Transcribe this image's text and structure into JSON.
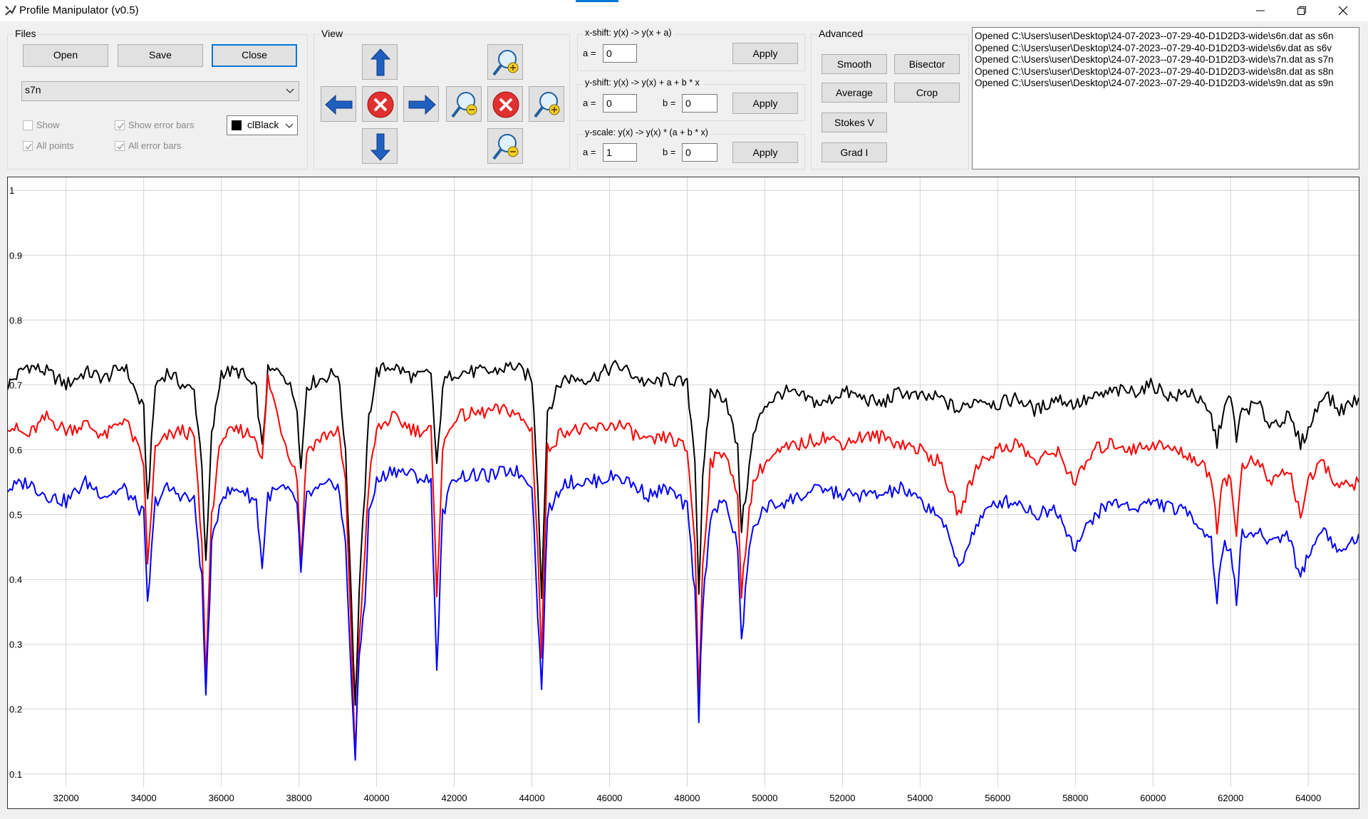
{
  "window": {
    "title": "Profile Manipulator (v0.5)"
  },
  "files": {
    "group_label": "Files",
    "open_label": "Open",
    "save_label": "Save",
    "close_label": "Close",
    "selected_profile": "s7n",
    "show_label": "Show",
    "show_checked": false,
    "show_error_bars_label": "Show error bars",
    "show_error_bars_checked": true,
    "all_points_label": "All points",
    "all_points_checked": true,
    "all_error_bars_label": "All error bars",
    "all_error_bars_checked": true,
    "color_value": "clBlack",
    "color_swatch": "#000000"
  },
  "view": {
    "group_label": "View"
  },
  "xshift": {
    "label": "x-shift: y(x) -> y(x + a)",
    "a_label": "a =",
    "a_value": "0",
    "apply_label": "Apply"
  },
  "yshift": {
    "label": "y-shift: y(x) -> y(x) + a + b * x",
    "a_label": "a =",
    "a_value": "0",
    "b_label": "b =",
    "b_value": "0",
    "apply_label": "Apply"
  },
  "yscale": {
    "label": "y-scale: y(x) -> y(x) * (a + b * x)",
    "a_label": "a =",
    "a_value": "1",
    "b_label": "b =",
    "b_value": "0",
    "apply_label": "Apply"
  },
  "advanced": {
    "group_label": "Advanced",
    "smooth_label": "Smooth",
    "bisector_label": "Bisector",
    "average_label": "Average",
    "crop_label": "Crop",
    "stokes_label": "Stokes V",
    "grad_label": "Grad I"
  },
  "log": {
    "lines": [
      "Opened C:\\Users\\user\\Desktop\\24-07-2023--07-29-40-D1D2D3-wide\\s6n.dat as s6n",
      "Opened C:\\Users\\user\\Desktop\\24-07-2023--07-29-40-D1D2D3-wide\\s6v.dat as s6v",
      "Opened C:\\Users\\user\\Desktop\\24-07-2023--07-29-40-D1D2D3-wide\\s7n.dat as s7n",
      "Opened C:\\Users\\user\\Desktop\\24-07-2023--07-29-40-D1D2D3-wide\\s8n.dat as s8n",
      "Opened C:\\Users\\user\\Desktop\\24-07-2023--07-29-40-D1D2D3-wide\\s9n.dat as s9n"
    ]
  },
  "icons": {
    "app": "app-icon",
    "minimize": "minimize-icon",
    "maximize": "restore-icon",
    "close": "close-icon",
    "up": "arrow-up-icon",
    "down": "arrow-down-icon",
    "left": "arrow-left-icon",
    "right": "arrow-right-icon",
    "reset": "reset-x-icon",
    "zoom_in": "zoom-in-icon",
    "zoom_out": "zoom-out-icon"
  },
  "chart_data": {
    "type": "line",
    "xlim": [
      30500,
      65300
    ],
    "ylim": [
      0.08,
      1.02
    ],
    "grid": true,
    "x_ticks": [
      32000,
      34000,
      36000,
      38000,
      40000,
      42000,
      44000,
      46000,
      48000,
      50000,
      52000,
      54000,
      56000,
      58000,
      60000,
      62000,
      64000
    ],
    "y_ticks": [
      0.1,
      0.2,
      0.3,
      0.4,
      0.5,
      0.6,
      0.7,
      0.8,
      0.9,
      1
    ],
    "y_tick_labels": [
      "0.1",
      "0.2",
      "0.3",
      "0.4",
      "0.5",
      "0.6",
      "0.7",
      "0.8",
      "0.9",
      "1"
    ],
    "series": [
      {
        "color": "#000000",
        "x": [
          30500,
          31000,
          31500,
          32000,
          32500,
          33000,
          33500,
          34000,
          34100,
          34300,
          34600,
          35000,
          35300,
          35500,
          35600,
          35750,
          36000,
          36500,
          36900,
          37050,
          37200,
          37600,
          37950,
          38050,
          38200,
          38600,
          39000,
          39200,
          39350,
          39450,
          39550,
          39700,
          39800,
          40000,
          40400,
          41000,
          41400,
          41550,
          41700,
          42000,
          43000,
          43500,
          44000,
          44150,
          44250,
          44400,
          44800,
          45500,
          46200,
          46500,
          47000,
          47500,
          48000,
          48200,
          48300,
          48400,
          48600,
          49000,
          49300,
          49400,
          49550,
          49700,
          50000,
          50500,
          51000,
          51500,
          52000,
          52500,
          53000,
          53500,
          54000,
          54500,
          55000,
          55500,
          56000,
          56500,
          57000,
          57500,
          58000,
          58500,
          59000,
          59500,
          60000,
          60500,
          61000,
          61500,
          61650,
          61800,
          62000,
          62150,
          62300,
          62700,
          63000,
          63500,
          63800,
          64000,
          64400,
          64800,
          65300
        ],
        "y": [
          0.7,
          0.73,
          0.72,
          0.7,
          0.72,
          0.71,
          0.73,
          0.66,
          0.52,
          0.7,
          0.72,
          0.7,
          0.69,
          0.58,
          0.42,
          0.62,
          0.72,
          0.72,
          0.69,
          0.6,
          0.72,
          0.72,
          0.67,
          0.57,
          0.7,
          0.71,
          0.72,
          0.6,
          0.37,
          0.2,
          0.38,
          0.54,
          0.65,
          0.72,
          0.73,
          0.71,
          0.72,
          0.57,
          0.7,
          0.72,
          0.72,
          0.73,
          0.71,
          0.55,
          0.38,
          0.66,
          0.71,
          0.71,
          0.73,
          0.72,
          0.7,
          0.71,
          0.7,
          0.59,
          0.38,
          0.55,
          0.69,
          0.68,
          0.6,
          0.48,
          0.55,
          0.62,
          0.67,
          0.69,
          0.68,
          0.67,
          0.69,
          0.68,
          0.67,
          0.69,
          0.68,
          0.68,
          0.66,
          0.68,
          0.67,
          0.68,
          0.66,
          0.68,
          0.67,
          0.68,
          0.69,
          0.69,
          0.7,
          0.68,
          0.69,
          0.65,
          0.61,
          0.66,
          0.68,
          0.62,
          0.66,
          0.67,
          0.64,
          0.65,
          0.61,
          0.63,
          0.69,
          0.66,
          0.68
        ]
      },
      {
        "color": "#ff0000",
        "x": [
          30500,
          31000,
          31500,
          32000,
          32500,
          33000,
          33500,
          34000,
          34100,
          34300,
          34600,
          35000,
          35300,
          35500,
          35600,
          35750,
          36000,
          36500,
          36900,
          37050,
          37200,
          37600,
          37950,
          38050,
          38200,
          38600,
          39000,
          39200,
          39350,
          39450,
          39550,
          39700,
          39800,
          40000,
          40400,
          41000,
          41400,
          41550,
          41700,
          42000,
          43000,
          43500,
          44000,
          44150,
          44250,
          44400,
          44800,
          45500,
          46200,
          46500,
          47000,
          47500,
          48000,
          48200,
          48300,
          48400,
          48600,
          49000,
          49300,
          49400,
          49550,
          49700,
          50000,
          50500,
          51000,
          51500,
          52000,
          52500,
          53000,
          53500,
          54000,
          54500,
          55000,
          55500,
          56000,
          56500,
          57000,
          57500,
          58000,
          58500,
          59000,
          59500,
          60000,
          60500,
          61000,
          61500,
          61650,
          61800,
          62000,
          62150,
          62300,
          62700,
          63000,
          63500,
          63800,
          64000,
          64400,
          64800,
          65300
        ],
        "y": [
          0.64,
          0.62,
          0.65,
          0.63,
          0.64,
          0.62,
          0.65,
          0.58,
          0.42,
          0.6,
          0.62,
          0.63,
          0.62,
          0.45,
          0.25,
          0.5,
          0.62,
          0.63,
          0.62,
          0.58,
          0.71,
          0.62,
          0.56,
          0.43,
          0.6,
          0.62,
          0.63,
          0.55,
          0.3,
          0.13,
          0.3,
          0.45,
          0.55,
          0.63,
          0.65,
          0.63,
          0.63,
          0.38,
          0.6,
          0.65,
          0.66,
          0.66,
          0.63,
          0.45,
          0.28,
          0.6,
          0.63,
          0.63,
          0.64,
          0.63,
          0.61,
          0.62,
          0.6,
          0.46,
          0.22,
          0.42,
          0.58,
          0.6,
          0.52,
          0.38,
          0.48,
          0.55,
          0.58,
          0.6,
          0.61,
          0.62,
          0.61,
          0.62,
          0.62,
          0.61,
          0.6,
          0.58,
          0.5,
          0.58,
          0.6,
          0.61,
          0.58,
          0.6,
          0.55,
          0.6,
          0.61,
          0.6,
          0.61,
          0.6,
          0.59,
          0.56,
          0.48,
          0.56,
          0.55,
          0.47,
          0.58,
          0.58,
          0.55,
          0.57,
          0.5,
          0.55,
          0.58,
          0.54,
          0.55
        ]
      },
      {
        "color": "#0000ff",
        "x": [
          30500,
          31000,
          31500,
          32000,
          32500,
          33000,
          33500,
          34000,
          34100,
          34300,
          34600,
          35000,
          35300,
          35500,
          35600,
          35750,
          36000,
          36500,
          36900,
          37050,
          37200,
          37600,
          37950,
          38050,
          38200,
          38600,
          39000,
          39200,
          39350,
          39450,
          39550,
          39700,
          39800,
          40000,
          40400,
          41000,
          41400,
          41550,
          41700,
          42000,
          43000,
          43500,
          44000,
          44150,
          44250,
          44400,
          44800,
          45500,
          46200,
          46500,
          47000,
          47500,
          48000,
          48200,
          48300,
          48400,
          48600,
          49000,
          49300,
          49400,
          49550,
          49700,
          50000,
          50500,
          51000,
          51500,
          52000,
          52500,
          53000,
          53500,
          54000,
          54500,
          55000,
          55500,
          56000,
          56500,
          57000,
          57500,
          58000,
          58500,
          59000,
          59500,
          60000,
          60500,
          61000,
          61500,
          61650,
          61800,
          62000,
          62150,
          62300,
          62700,
          63000,
          63500,
          63800,
          64000,
          64400,
          64800,
          65300
        ],
        "y": [
          0.54,
          0.55,
          0.53,
          0.52,
          0.55,
          0.53,
          0.54,
          0.5,
          0.36,
          0.52,
          0.54,
          0.53,
          0.52,
          0.4,
          0.22,
          0.45,
          0.53,
          0.54,
          0.52,
          0.42,
          0.53,
          0.54,
          0.52,
          0.41,
          0.53,
          0.54,
          0.55,
          0.45,
          0.25,
          0.12,
          0.28,
          0.37,
          0.5,
          0.55,
          0.57,
          0.56,
          0.55,
          0.26,
          0.5,
          0.56,
          0.56,
          0.57,
          0.55,
          0.35,
          0.23,
          0.5,
          0.55,
          0.55,
          0.56,
          0.55,
          0.53,
          0.54,
          0.51,
          0.38,
          0.19,
          0.36,
          0.5,
          0.52,
          0.45,
          0.3,
          0.42,
          0.48,
          0.51,
          0.52,
          0.53,
          0.54,
          0.53,
          0.53,
          0.53,
          0.54,
          0.52,
          0.5,
          0.42,
          0.49,
          0.52,
          0.52,
          0.5,
          0.51,
          0.45,
          0.5,
          0.52,
          0.51,
          0.52,
          0.51,
          0.5,
          0.46,
          0.37,
          0.45,
          0.45,
          0.37,
          0.47,
          0.47,
          0.46,
          0.47,
          0.4,
          0.44,
          0.48,
          0.44,
          0.47
        ]
      }
    ]
  }
}
